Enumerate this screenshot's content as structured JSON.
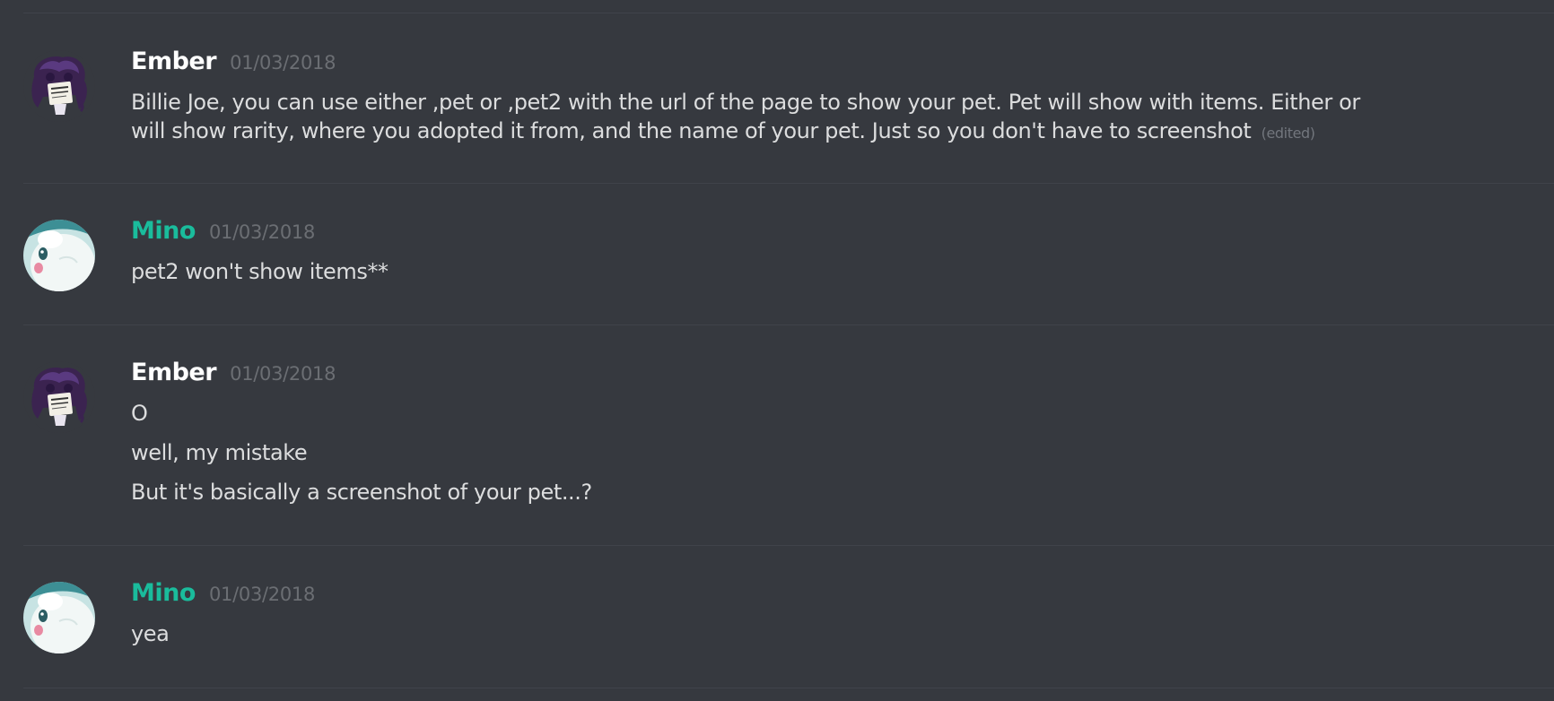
{
  "messages": [
    {
      "author": "Ember",
      "author_color": "#ffffff",
      "avatar_icon": "ember-avatar",
      "timestamp": "01/03/2018",
      "lines": [
        "Billie Joe, you can use either ,pet or ,pet2  with the url of the page to show your pet. Pet will show with items. Either or",
        "will show rarity, where you adopted it from, and the name of your pet. Just so you don't have to screenshot"
      ],
      "edited_label": "(edited)"
    },
    {
      "author": "Mino",
      "author_color": "#1abc9c",
      "avatar_icon": "mino-avatar",
      "timestamp": "01/03/2018",
      "lines": [
        "pet2 won't show items**"
      ]
    },
    {
      "author": "Ember",
      "author_color": "#ffffff",
      "avatar_icon": "ember-avatar",
      "timestamp": "01/03/2018",
      "lines": [
        "O",
        "well, my mistake",
        "But it's basically a screenshot of your pet...?"
      ]
    },
    {
      "author": "Mino",
      "author_color": "#1abc9c",
      "avatar_icon": "mino-avatar",
      "timestamp": "01/03/2018",
      "lines": [
        "yea"
      ]
    }
  ]
}
